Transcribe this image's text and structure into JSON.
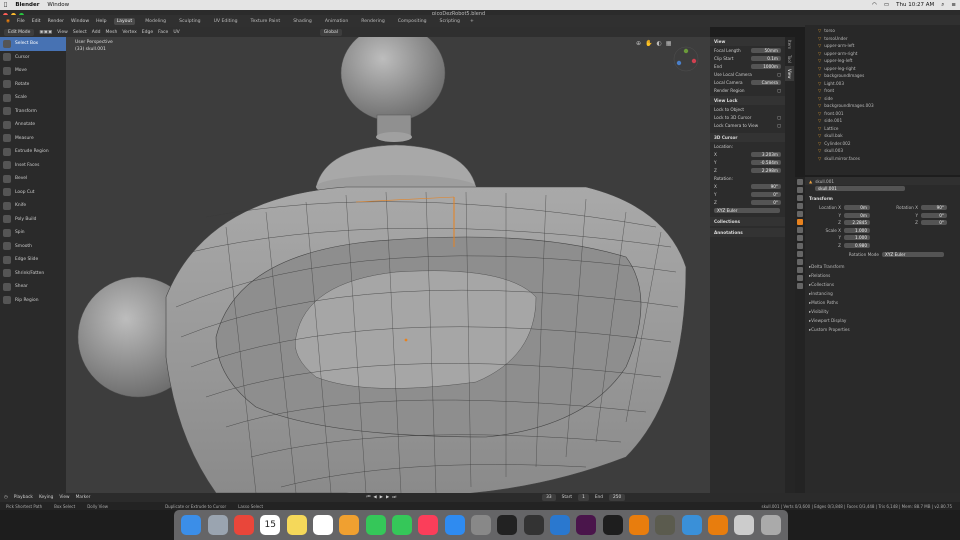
{
  "macos_menu": {
    "app_name": "Blender",
    "items": [
      "Window"
    ],
    "right": {
      "datetime": "Thu 10:27 AM"
    }
  },
  "window": {
    "title": "picoDezRobot5.blend"
  },
  "topbar": {
    "menus": [
      "File",
      "Edit",
      "Render",
      "Window",
      "Help"
    ],
    "workspaces": [
      "Layout",
      "Modeling",
      "Sculpting",
      "UV Editing",
      "Texture Paint",
      "Shading",
      "Animation",
      "Rendering",
      "Compositing",
      "Scripting"
    ],
    "active_workspace": "Layout",
    "scene_label": "Scene",
    "view_layer_label": "View Layer"
  },
  "header": {
    "mode": "Edit Mode",
    "menus": [
      "View",
      "Select",
      "Add",
      "Mesh",
      "Vertex",
      "Edge",
      "Face",
      "UV"
    ],
    "transform_orientation": "Global"
  },
  "toolbar": {
    "tools": [
      "Select Box",
      "Cursor",
      "Move",
      "Rotate",
      "Scale",
      "Transform",
      "Annotate",
      "Measure",
      "Extrude Region",
      "Inset Faces",
      "Bevel",
      "Loop Cut",
      "Knife",
      "Poly Build",
      "Spin",
      "Smooth",
      "Edge Slide",
      "Shrink/Fatten",
      "Shear",
      "Rip Region"
    ],
    "active": "Select Box"
  },
  "viewport": {
    "view_name": "User Perspective",
    "object_name": "(33) skull.001"
  },
  "npanel": {
    "view_section": "View",
    "focal_length_label": "Focal Length",
    "focal_length": "50mm",
    "clip_start_label": "Clip Start",
    "clip_start": "0.1m",
    "clip_end_label": "End",
    "clip_end": "1000m",
    "use_local_camera": "Use Local Camera",
    "local_camera_label": "Local Camera",
    "local_camera": "Camera",
    "render_region": "Render Region",
    "view_lock_section": "View Lock",
    "lock_to_object": "Lock to Object",
    "lock_3d_cursor": "Lock to 3D Cursor",
    "lock_camera_to_view": "Lock Camera to View",
    "cursor_section": "3D Cursor",
    "location_label": "Location:",
    "loc_x": "3.203m",
    "loc_y": "-0.584m",
    "loc_z": "2.298m",
    "rotation_label": "Rotation:",
    "rot_x": "90°",
    "rot_y": "0°",
    "rot_z": "0°",
    "rotation_mode": "XYZ Euler",
    "collections": "Collections",
    "annotations": "Annotations",
    "tabs": [
      "Item",
      "Tool",
      "View"
    ]
  },
  "outliner": {
    "items": [
      "torso",
      "torsoUnder",
      "upper-arm-left",
      "upper-arm-right",
      "upper-leg-left",
      "upper-leg-right",
      "backgroundImages",
      "Light.003",
      "front",
      "side",
      "backgroundImages.003",
      "front.001",
      "side.001",
      "Lattice",
      "skull.bak",
      "Cylinder.002",
      "skull.003",
      "skull.mirror.faces"
    ]
  },
  "properties": {
    "object_name": "skull.001",
    "mesh_name": "skull.001",
    "transform_section": "Transform",
    "location_label": "Location X",
    "loc_x": "0m",
    "loc_y": "0m",
    "loc_z": "2.2845",
    "rotation_label": "Rotation X",
    "rot_x": "90°",
    "rot_y": "0°",
    "rot_z": "0°",
    "scale_label": "Scale X",
    "scale_x": "1.000",
    "scale_y": "1.000",
    "scale_z": "0.980",
    "rotation_mode_label": "Rotation Mode",
    "rotation_mode": "XYZ Euler",
    "sections": [
      "Delta Transform",
      "Relations",
      "Collections",
      "Instancing",
      "Motion Paths",
      "Visibility",
      "Viewport Display",
      "Custom Properties"
    ]
  },
  "timeline": {
    "menus": [
      "Playback",
      "Keying",
      "View",
      "Marker"
    ],
    "current_frame": "33",
    "start_label": "Start",
    "start": "1",
    "end_label": "End",
    "end": "250"
  },
  "status": {
    "left": [
      "Pick Shortest Path",
      "Box Select",
      "Dolly View"
    ],
    "mid": [
      "Duplicate or Extrude to Cursor",
      "Lasso Select"
    ],
    "right": "skull.001 | Verts 0/3,600 | Edges 0/3,848 | Faces 0/3,448 | Tris 6,148 | Mem: 88.7 MB | v2.80.75"
  },
  "dock": {
    "calendar_day": "15",
    "apps": [
      "finder",
      "launchpad",
      "chrome",
      "calendar",
      "notes",
      "reminders",
      "photos",
      "messages",
      "facetime",
      "music",
      "appstore",
      "system-preferences",
      "terminal",
      "unity",
      "vscode",
      "slack",
      "figma",
      "blender",
      "gimp",
      "folder",
      "blender-alt",
      "preview",
      "trash"
    ]
  }
}
